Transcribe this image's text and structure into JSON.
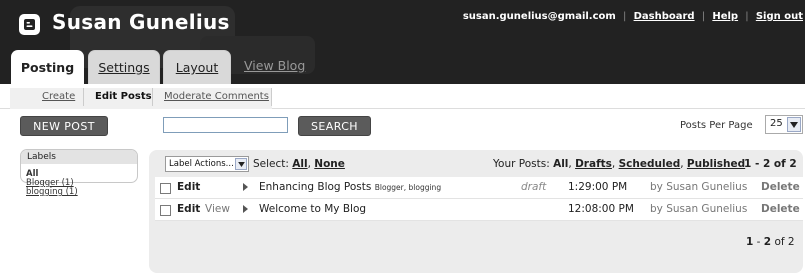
{
  "header": {
    "blog_title": "Susan Gunelius",
    "user_email": "susan.gunelius@gmail.com",
    "links": [
      "Dashboard",
      "Help",
      "Sign out"
    ]
  },
  "tabs": [
    {
      "label": "Posting",
      "active": true
    },
    {
      "label": "Settings",
      "active": false
    },
    {
      "label": "Layout",
      "active": false
    }
  ],
  "view_blog": "View Blog",
  "subnav": {
    "create": "Create",
    "edit_posts": "Edit Posts",
    "moderate": "Moderate Comments"
  },
  "toolbar": {
    "new_post": "NEW POST",
    "search_value": "",
    "search_button": "SEARCH",
    "posts_per_page_label": "Posts Per Page",
    "posts_per_page_value": "25"
  },
  "labels_panel": {
    "title": "Labels",
    "items": [
      {
        "label": "All",
        "link": false
      },
      {
        "label": "Blogger (1)",
        "link": true
      },
      {
        "label": "blogging (1)",
        "link": true
      }
    ]
  },
  "list_header": {
    "label_actions": "Label Actions...",
    "select_prefix": "Select:",
    "select_all": "All",
    "select_none": "None",
    "your_posts": "Your Posts:",
    "filter_all": "All",
    "filter_drafts": "Drafts",
    "filter_scheduled": "Scheduled",
    "filter_published": "Published",
    "range": "1 - 2 of 2"
  },
  "posts": [
    {
      "edit": "Edit",
      "view": "",
      "title": "Enhancing Blog Posts",
      "labels": "Blogger, blogging",
      "status": "draft",
      "time": "1:29:00 PM",
      "author": "by Susan Gunelius",
      "delete": "Delete"
    },
    {
      "edit": "Edit",
      "view": "View",
      "title": "Welcome to My Blog",
      "labels": "",
      "status": "",
      "time": "12:08:00 PM",
      "author": "by Susan Gunelius",
      "delete": "Delete"
    }
  ],
  "footer": {
    "range_start": "1",
    "range_end": "2",
    "range_of": "of 2"
  },
  "colors": {
    "header_bg": "#222222",
    "button_bg": "#5b5b5b",
    "panel_bg": "#ececec"
  }
}
